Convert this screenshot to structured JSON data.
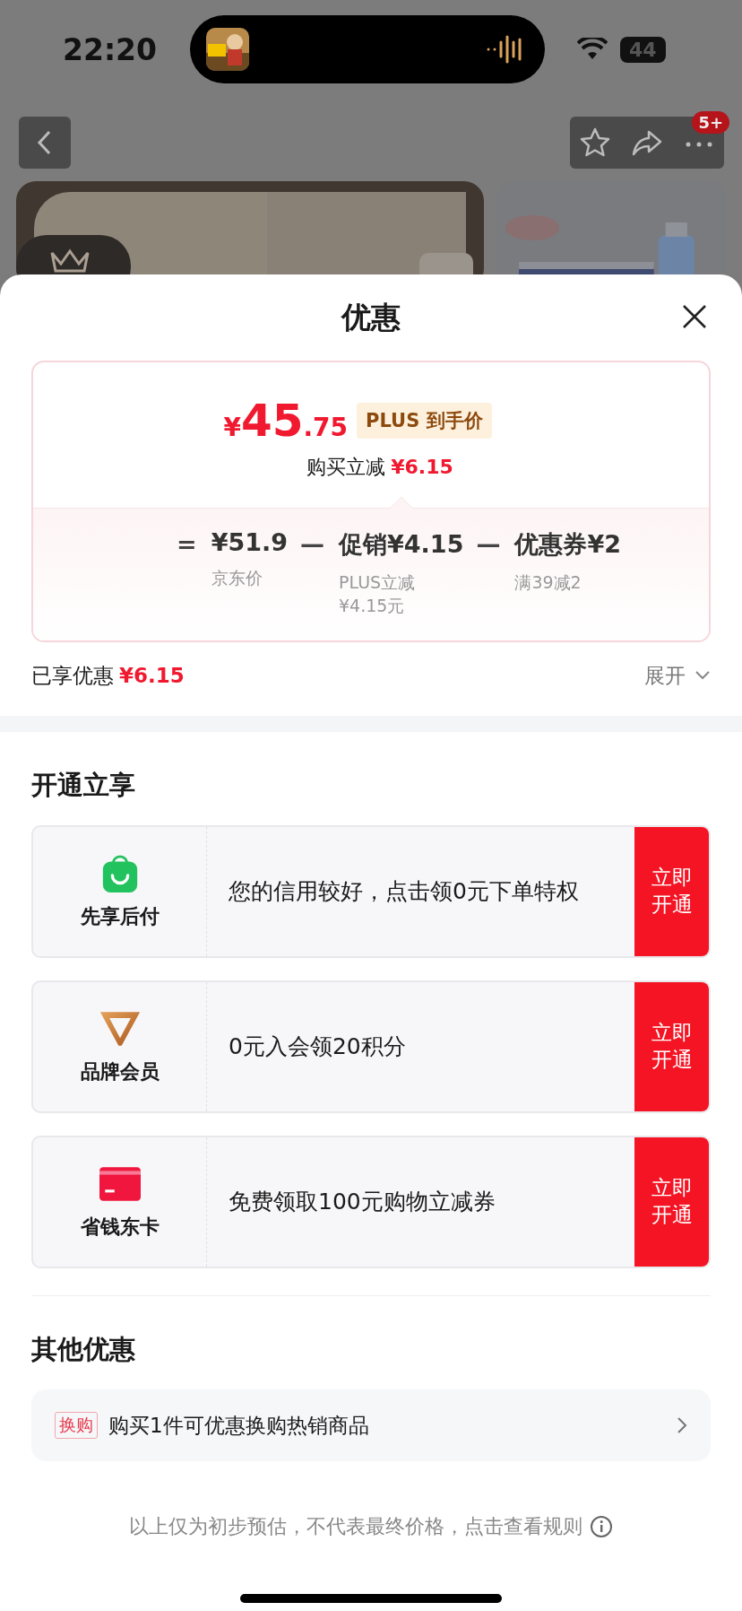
{
  "status_bar": {
    "time": "22:20",
    "battery": "44"
  },
  "nav": {
    "badge": "5+"
  },
  "sheet": {
    "title": "优惠"
  },
  "price_card": {
    "currency": "¥",
    "integer": "45",
    "decimal": ".75",
    "tag": "PLUS 到手价",
    "saving_label": "购买立减",
    "saving_value": "¥6.15",
    "terms": [
      {
        "operator": "=",
        "amount": "¥51.9",
        "note": [
          "京东价"
        ]
      },
      {
        "operator": "—",
        "amount": "促销¥4.15",
        "note": [
          "PLUS立减",
          "¥4.15元"
        ]
      },
      {
        "operator": "—",
        "amount": "优惠券¥2",
        "note": [
          "满39减2"
        ]
      }
    ]
  },
  "enjoyed": {
    "label": "已享优惠",
    "value": "¥6.15",
    "toggle": "展开"
  },
  "open_section": {
    "title": "开通立享",
    "offers": [
      {
        "kind": "bag",
        "name": "先享后付",
        "desc": "您的信用较好，点击领0元下单特权",
        "button": "立即开通"
      },
      {
        "kind": "v",
        "name": "品牌会员",
        "desc": "0元入会领20积分",
        "button": "立即开通"
      },
      {
        "kind": "card",
        "name": "省钱东卡",
        "desc": "免费领取100元购物立减券",
        "button": "立即开通"
      }
    ]
  },
  "other_section": {
    "title": "其他优惠",
    "items": [
      {
        "tag": "换购",
        "text": "购买1件可优惠换购热销商品"
      }
    ]
  },
  "footer": {
    "text": "以上仅为初步预估，不代表最终价格，点击查看规则"
  }
}
